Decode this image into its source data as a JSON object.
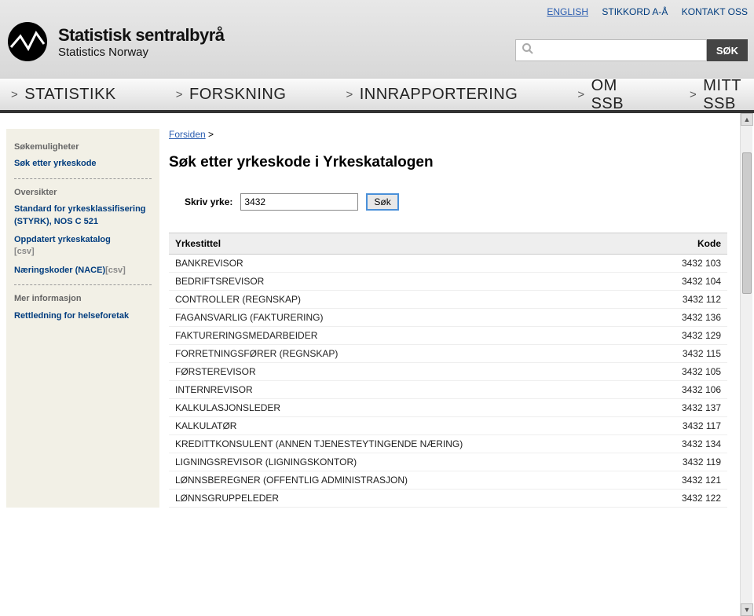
{
  "top_links": {
    "english": "ENGLISH",
    "stikkord": "STIKKORD A-Å",
    "kontakt": "KONTAKT OSS"
  },
  "header_search": {
    "button": "SØK"
  },
  "logo": {
    "line1": "Statistisk sentralbyrå",
    "line2": "Statistics Norway"
  },
  "nav": [
    "STATISTIKK",
    "FORSKNING",
    "INNRAPPORTERING",
    "OM SSB",
    "MITT SSB"
  ],
  "sidebar": {
    "sokemuligheter": "Søkemuligheter",
    "sok_yrkeskode": "Søk etter yrkeskode",
    "oversikter": "Oversikter",
    "styrk": "Standard for yrkesklassifisering (STYRK), NOS C 521",
    "oppdatert": "Oppdatert yrkeskatalog",
    "csv": "[csv]",
    "nace_label": "Næringskoder (NACE)",
    "nace_csv": "[csv]",
    "mer_info": "Mer informasjon",
    "rettledning": "Rettledning for helseforetak"
  },
  "breadcrumb": {
    "forsiden": "Forsiden",
    "sep": ">"
  },
  "page_title": "Søk etter yrkeskode i Yrkeskatalogen",
  "form": {
    "label": "Skriv yrke:",
    "value": "3432",
    "button": "Søk"
  },
  "table": {
    "header_title": "Yrkestittel",
    "header_code": "Kode",
    "rows": [
      {
        "title": "BANKREVISOR",
        "code": "3432 103"
      },
      {
        "title": "BEDRIFTSREVISOR",
        "code": "3432 104"
      },
      {
        "title": "CONTROLLER (REGNSKAP)",
        "code": "3432 112"
      },
      {
        "title": "FAGANSVARLIG (FAKTURERING)",
        "code": "3432 136"
      },
      {
        "title": "FAKTURERINGSMEDARBEIDER",
        "code": "3432 129"
      },
      {
        "title": "FORRETNINGSFØRER (REGNSKAP)",
        "code": "3432 115"
      },
      {
        "title": "FØRSTEREVISOR",
        "code": "3432 105"
      },
      {
        "title": "INTERNREVISOR",
        "code": "3432 106"
      },
      {
        "title": "KALKULASJONSLEDER",
        "code": "3432 137"
      },
      {
        "title": "KALKULATØR",
        "code": "3432 117"
      },
      {
        "title": "KREDITTKONSULENT (ANNEN TJENESTEYTINGENDE NÆRING)",
        "code": "3432 134"
      },
      {
        "title": "LIGNINGSREVISOR (LIGNINGSKONTOR)",
        "code": "3432 119"
      },
      {
        "title": "LØNNSBEREGNER (OFFENTLIG ADMINISTRASJON)",
        "code": "3432 121"
      },
      {
        "title": "LØNNSGRUPPELEDER",
        "code": "3432 122"
      }
    ]
  }
}
